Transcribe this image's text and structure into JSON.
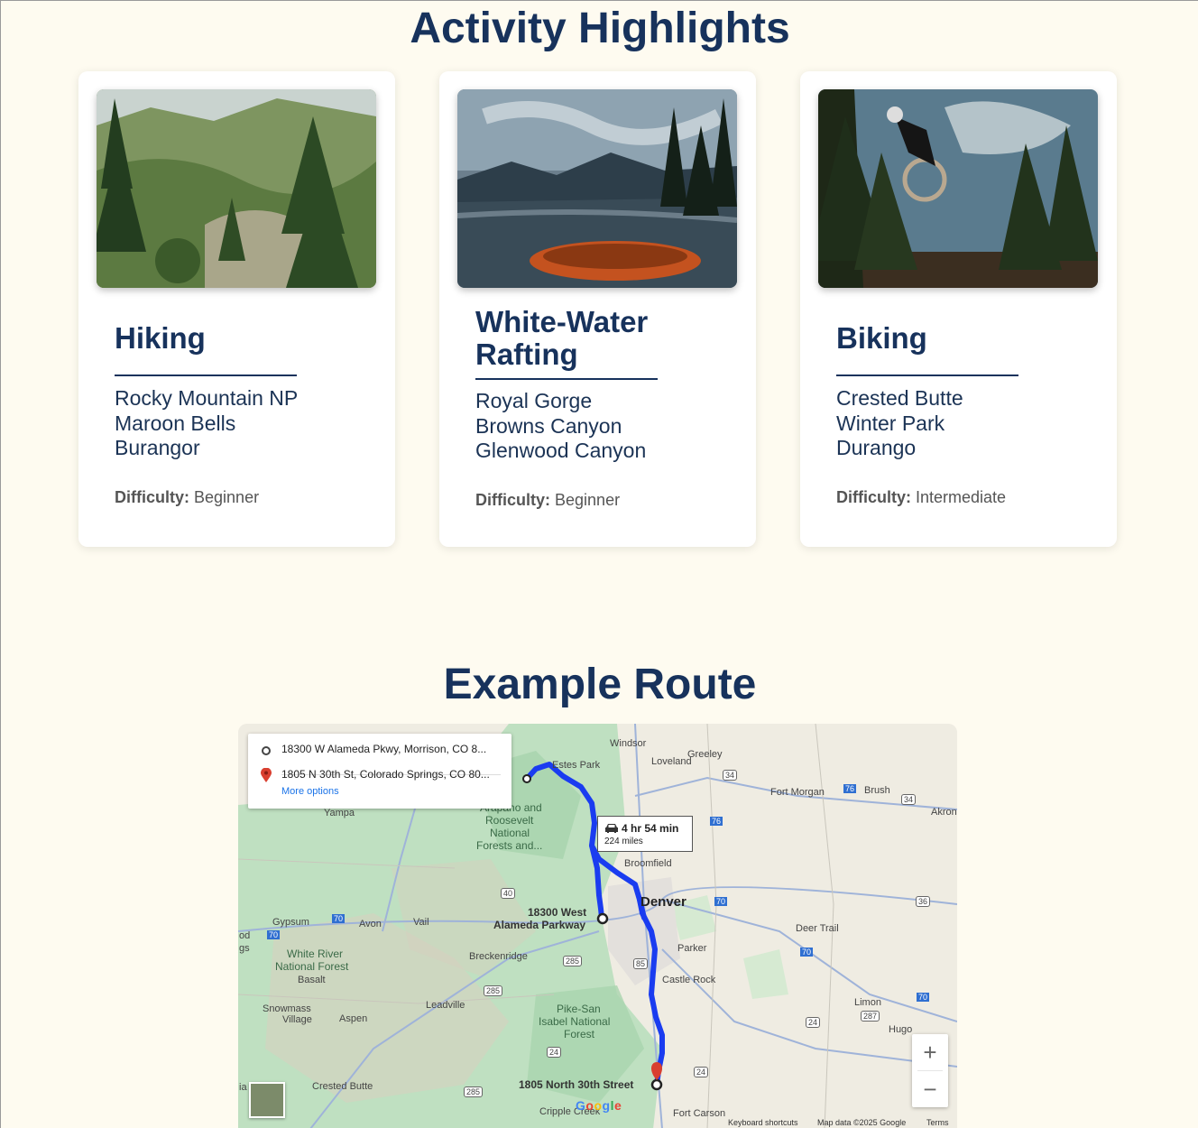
{
  "activities": {
    "title": "Activity Highlights",
    "cards": [
      {
        "name": "Hiking",
        "locations": [
          "Rocky Mountain NP",
          "Maroon Bells",
          "Burangor"
        ],
        "difficulty_label": "Difficulty:",
        "difficulty": "Beginner"
      },
      {
        "name": "White-Water Rafting",
        "locations": [
          "Royal Gorge",
          "Browns Canyon",
          "Glenwood Canyon"
        ],
        "difficulty_label": "Difficulty:",
        "difficulty": "Beginner"
      },
      {
        "name": "Biking",
        "locations": [
          "Crested Butte",
          "Winter Park",
          "Durango"
        ],
        "difficulty_label": "Difficulty:",
        "difficulty": "Intermediate"
      }
    ]
  },
  "route": {
    "title": "Example Route",
    "origin": "18300 W Alameda Pkwy, Morrison, CO 8...",
    "destination": "1805 N 30th St, Colorado Springs, CO 80...",
    "more_options": "More options",
    "duration": "4 hr 54 min",
    "distance": "224 miles",
    "zoom_in": "+",
    "zoom_out": "−",
    "footer": {
      "shortcuts": "Keyboard shortcuts",
      "mapdata": "Map data ©2025 Google",
      "terms": "Terms"
    },
    "google": "Google",
    "labels": {
      "windsor": "Windsor",
      "greeley": "Greeley",
      "loveland": "Loveland",
      "estes": "Estes Park",
      "arapaho": "Arapaho and",
      "roosevelt": "Roosevelt",
      "national": "National",
      "forests": "Forests and...",
      "fortmorgan": "Fort Morgan",
      "brush": "Brush",
      "akron": "Akron",
      "yampa": "Yampa",
      "broomfield": "Broomfield",
      "denver": "Denver",
      "origin_label_1": "18300 West",
      "origin_label_2": "Alameda Parkway",
      "gypsum": "Gypsum",
      "avon": "Avon",
      "vail": "Vail",
      "deertrail": "Deer Trail",
      "whiteriver1": "White River",
      "whiteriver2": "National Forest",
      "basalt": "Basalt",
      "breckenridge": "Breckenridge",
      "parker": "Parker",
      "castlerock": "Castle Rock",
      "leadville": "Leadville",
      "snowmass1": "Snowmass",
      "snowmass2": "Village",
      "aspen": "Aspen",
      "pikesan1": "Pike-San",
      "pikesan2": "Isabel National",
      "pikesan3": "Forest",
      "limon": "Limon",
      "hugo": "Hugo",
      "crestedbutte": "Crested Butte",
      "dest_label": "1805 North 30th Street",
      "cripple": "Cripple Creek",
      "fortcarson": "Fort Carson",
      "i70a": "70",
      "i70b": "70",
      "i70c": "70",
      "i70d": "70",
      "i76a": "76",
      "i76b": "76",
      "r34a": "34",
      "r34b": "34",
      "r36": "36",
      "r40": "40",
      "r285a": "285",
      "r285b": "285",
      "r285c": "285",
      "r85": "85",
      "r24a": "24",
      "r24b": "24",
      "r24c": "24",
      "r287": "287",
      "r70e": "70",
      "od": "od",
      "gs": "gs",
      "ia": "ia"
    }
  },
  "colors": {
    "title": "#17325c",
    "background": "#fefbf0",
    "route": "#1a3cf0"
  },
  "icons": [
    "origin-circle-icon",
    "destination-pin-icon",
    "car-icon",
    "zoom-in-icon",
    "zoom-out-icon"
  ]
}
